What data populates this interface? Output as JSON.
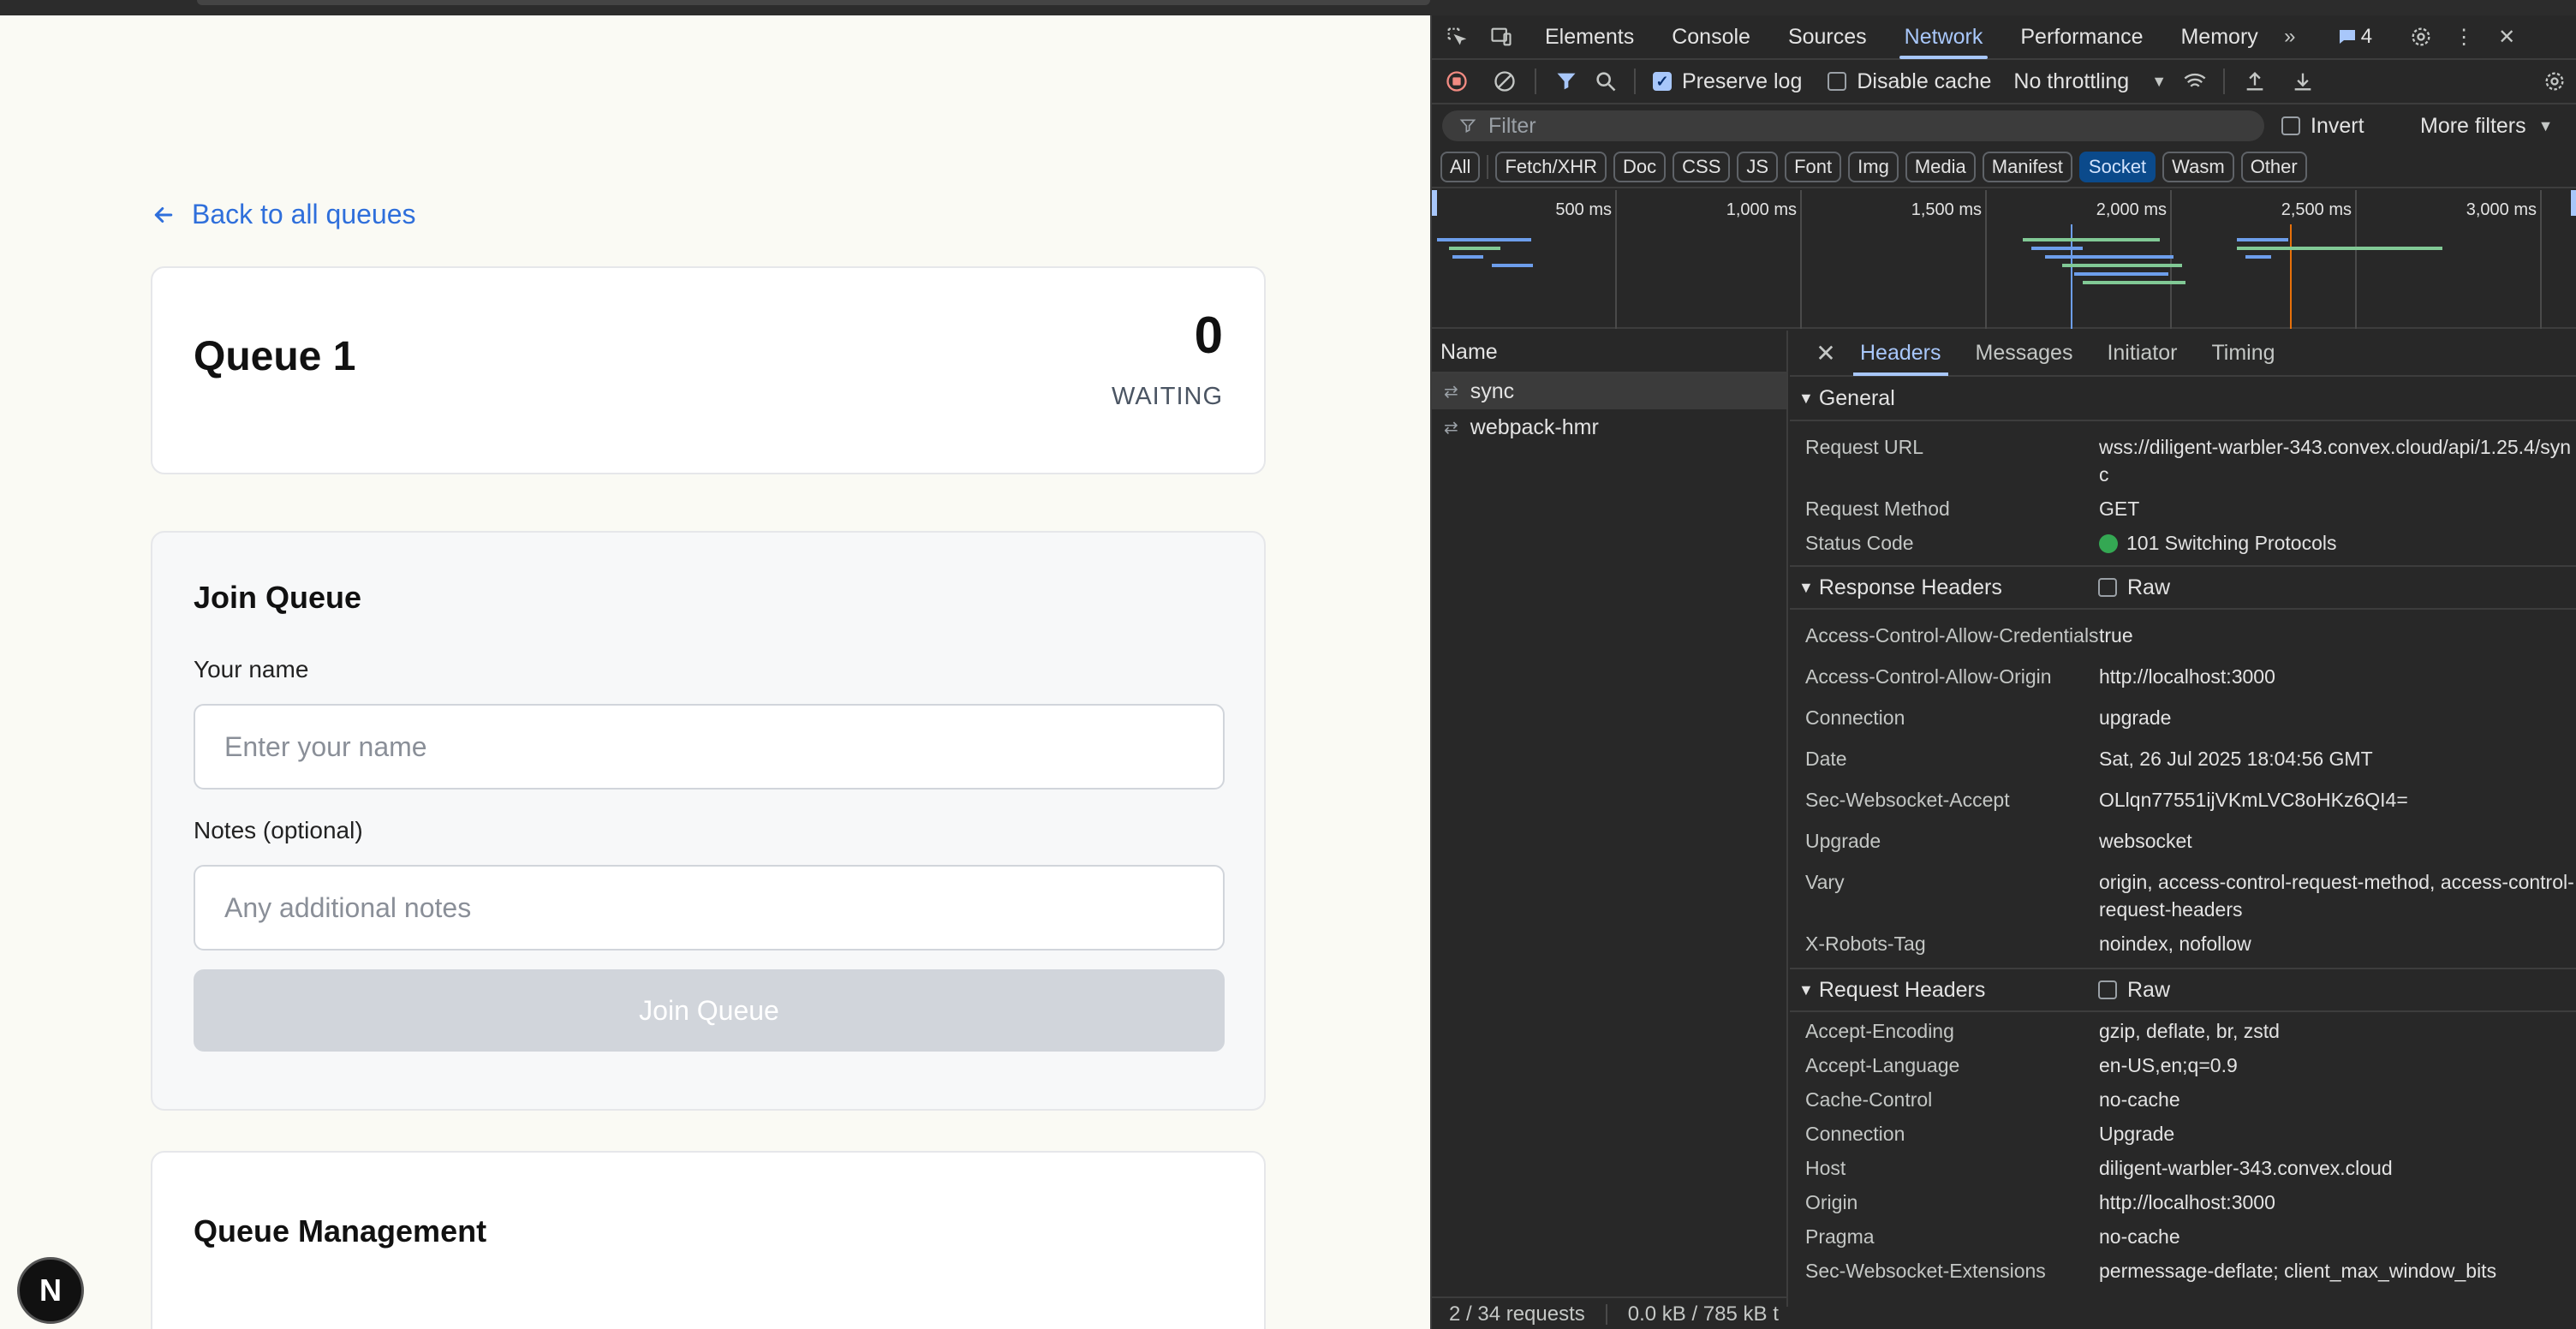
{
  "app": {
    "back_link": "Back to all queues",
    "queue": {
      "title": "Queue 1",
      "count": "0",
      "count_label": "WAITING"
    },
    "join": {
      "title": "Join Queue",
      "name_label": "Your name",
      "name_placeholder": "Enter your name",
      "notes_label": "Notes (optional)",
      "notes_placeholder": "Any additional notes",
      "button": "Join Queue"
    },
    "management": {
      "title": "Queue Management"
    },
    "next_badge": "N"
  },
  "devtools": {
    "tabs": [
      "Elements",
      "Console",
      "Sources",
      "Network",
      "Performance",
      "Memory"
    ],
    "active_tab": "Network",
    "issues_count": "4",
    "toolbar": {
      "preserve_log": "Preserve log",
      "disable_cache": "Disable cache",
      "throttling": "No throttling"
    },
    "filter": {
      "placeholder": "Filter",
      "invert": "Invert",
      "more_filters": "More filters"
    },
    "types": [
      "All",
      "Fetch/XHR",
      "Doc",
      "CSS",
      "JS",
      "Font",
      "Img",
      "Media",
      "Manifest",
      "Socket",
      "Wasm",
      "Other"
    ],
    "active_type": "Socket",
    "overview_ticks": [
      "500 ms",
      "1,000 ms",
      "1,500 ms",
      "2,000 ms",
      "2,500 ms",
      "3,000 ms"
    ],
    "name_header": "Name",
    "requests": [
      "sync",
      "webpack-hmr"
    ],
    "status": {
      "requests": "2 / 34 requests",
      "transferred": "0.0 kB / 785 kB t"
    },
    "detail_tabs": [
      "Headers",
      "Messages",
      "Initiator",
      "Timing"
    ],
    "general": {
      "title": "General",
      "rows": [
        {
          "k": "Request URL",
          "v": "wss://diligent-warbler-343.convex.cloud/api/1.25.4/sync"
        },
        {
          "k": "Request Method",
          "v": "GET"
        },
        {
          "k": "Status Code",
          "v": "101 Switching Protocols"
        }
      ]
    },
    "response_headers": {
      "title": "Response Headers",
      "raw": "Raw",
      "rows": [
        {
          "k": "Access-Control-Allow-Credentials",
          "v": "true"
        },
        {
          "k": "Access-Control-Allow-Origin",
          "v": "http://localhost:3000"
        },
        {
          "k": "Connection",
          "v": "upgrade"
        },
        {
          "k": "Date",
          "v": "Sat, 26 Jul 2025 18:04:56 GMT"
        },
        {
          "k": "Sec-Websocket-Accept",
          "v": "OLlqn77551ijVKmLVC8oHKz6QI4="
        },
        {
          "k": "Upgrade",
          "v": "websocket"
        },
        {
          "k": "Vary",
          "v": "origin, access-control-request-method, access-control-request-headers"
        },
        {
          "k": "X-Robots-Tag",
          "v": "noindex, nofollow"
        }
      ]
    },
    "request_headers": {
      "title": "Request Headers",
      "raw": "Raw",
      "rows": [
        {
          "k": "Accept-Encoding",
          "v": "gzip, deflate, br, zstd"
        },
        {
          "k": "Accept-Language",
          "v": "en-US,en;q=0.9"
        },
        {
          "k": "Cache-Control",
          "v": "no-cache"
        },
        {
          "k": "Connection",
          "v": "Upgrade"
        },
        {
          "k": "Host",
          "v": "diligent-warbler-343.convex.cloud"
        },
        {
          "k": "Origin",
          "v": "http://localhost:3000"
        },
        {
          "k": "Pragma",
          "v": "no-cache"
        },
        {
          "k": "Sec-Websocket-Extensions",
          "v": "permessage-deflate; client_max_window_bits"
        }
      ]
    },
    "colors": {
      "accent": "#a8c7fa",
      "status_ok": "#34a853",
      "link": "#2f6fdb"
    }
  }
}
